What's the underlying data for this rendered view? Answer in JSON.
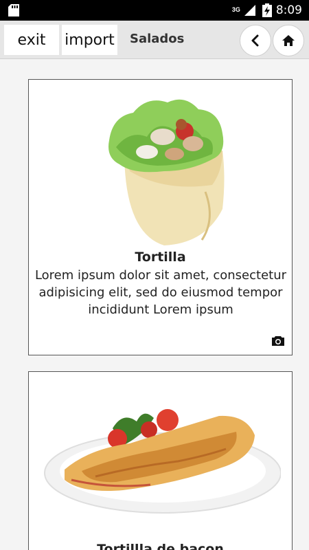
{
  "status_bar": {
    "time": "8:09",
    "network": "3G",
    "icons": [
      "sd-card-icon",
      "signal-icon",
      "battery-charging-icon"
    ]
  },
  "app_bar": {
    "exit_label": "exit",
    "import_label": "import",
    "title": "Salados",
    "back_icon": "chevron-left-icon",
    "home_icon": "home-icon"
  },
  "cards": [
    {
      "title": "Tortilla",
      "description": "Lorem ipsum dolor sit amet, consectetur adipisicing elit, sed do eiusmod tempor incididunt Lorem ipsum",
      "image": "tortilla-wrap-photo",
      "action_icon": "camera-icon"
    },
    {
      "title": "Tortillla de bacon",
      "image": "bacon-omelette-photo"
    }
  ],
  "colors": {
    "status_bar": "#000000",
    "app_bar": "#e6e6e6",
    "background": "#f4f4f4",
    "card_border": "#555555"
  }
}
